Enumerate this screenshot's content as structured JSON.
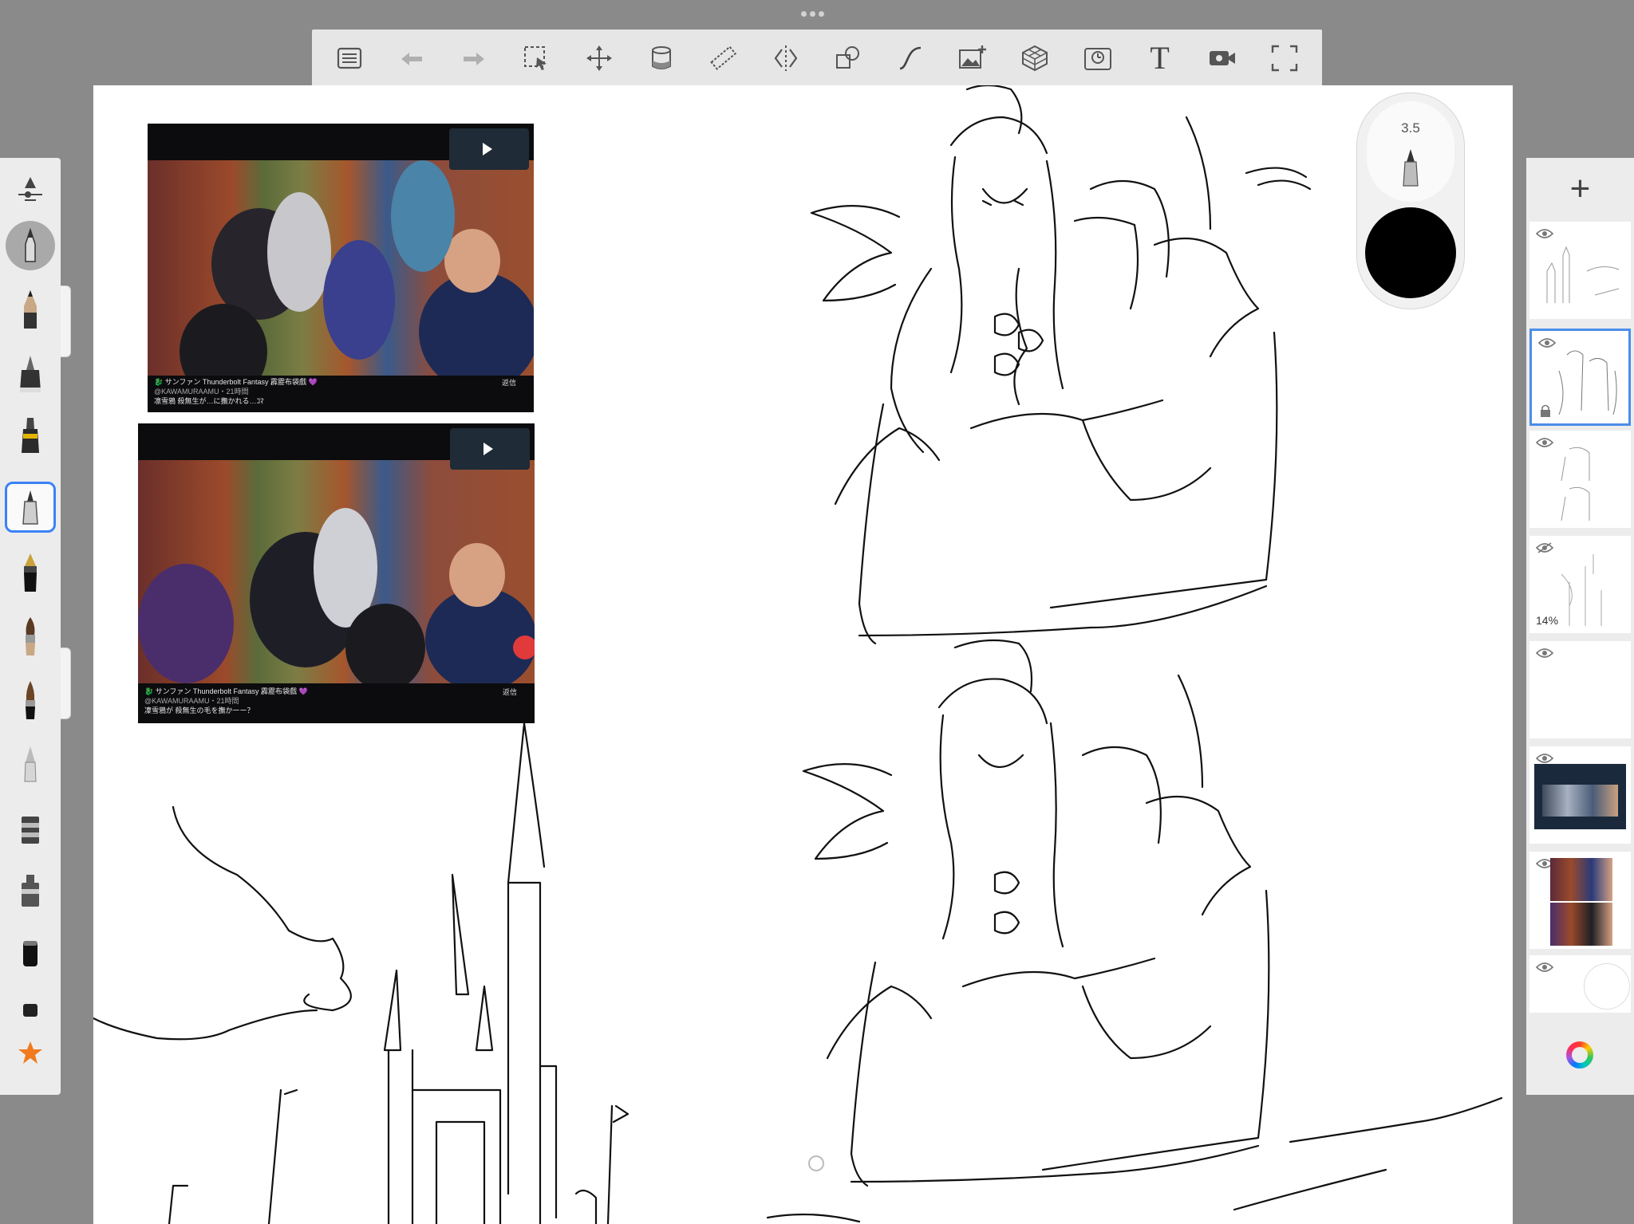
{
  "top_grip": "•••",
  "toolbar": {
    "icons": [
      "list-icon",
      "undo-icon",
      "redo-icon",
      "select-icon",
      "transform-icon",
      "fill-icon",
      "ruler-icon",
      "symmetry-icon",
      "shapes-icon",
      "curve-icon",
      "image-icon",
      "perspective-icon",
      "timelapse-icon",
      "text-icon",
      "record-icon",
      "fullscreen-icon"
    ],
    "text_tool_glyph": "T"
  },
  "brush_panel": {
    "icons": [
      "brush-settings-icon",
      "blender-brush-icon",
      "pencil-icon",
      "ink-pen-icon",
      "marker-icon",
      "technical-pen-icon",
      "fountain-pen-icon",
      "paintbrush-icon",
      "wet-brush-icon",
      "airbrush-icon",
      "spray-can-icon",
      "stamp-icon",
      "eraser-icon",
      "smudge-icon",
      "favorites-star-icon"
    ],
    "selected": "technical-pen-icon"
  },
  "brush_size": {
    "value": "3.5",
    "color": "#000000"
  },
  "reference_images": [
    {
      "channel_line": "🐉 サンファン Thunderbolt Fantasy 霹靂布袋戲 💜",
      "sub_line": "@KAWAMURAAMU・21時間",
      "caption": "凛雪鴉 殺無生が…に撫かれる…ｺﾏ",
      "tag": "返信"
    },
    {
      "channel_line": "🐉 サンファン Thunderbolt Fantasy 霹靂布袋戲 💜",
      "sub_line": "@KAWAMURAAMU・21時間",
      "caption": "凜雪鴉が 殺無生の毛を撫かーー？",
      "tag": "返信"
    }
  ],
  "layers": {
    "add_label": "+",
    "items": [
      {
        "name": "layer-1",
        "visible": true,
        "opacity": ""
      },
      {
        "name": "layer-2",
        "visible": true,
        "opacity": "",
        "selected": true
      },
      {
        "name": "layer-3",
        "visible": true,
        "opacity": ""
      },
      {
        "name": "layer-4",
        "visible": false,
        "opacity": "14%"
      },
      {
        "name": "layer-5",
        "visible": true,
        "opacity": ""
      },
      {
        "name": "layer-6",
        "visible": true,
        "opacity": ""
      },
      {
        "name": "layer-7",
        "visible": true,
        "opacity": ""
      },
      {
        "name": "layer-8",
        "visible": true,
        "opacity": ""
      }
    ]
  }
}
